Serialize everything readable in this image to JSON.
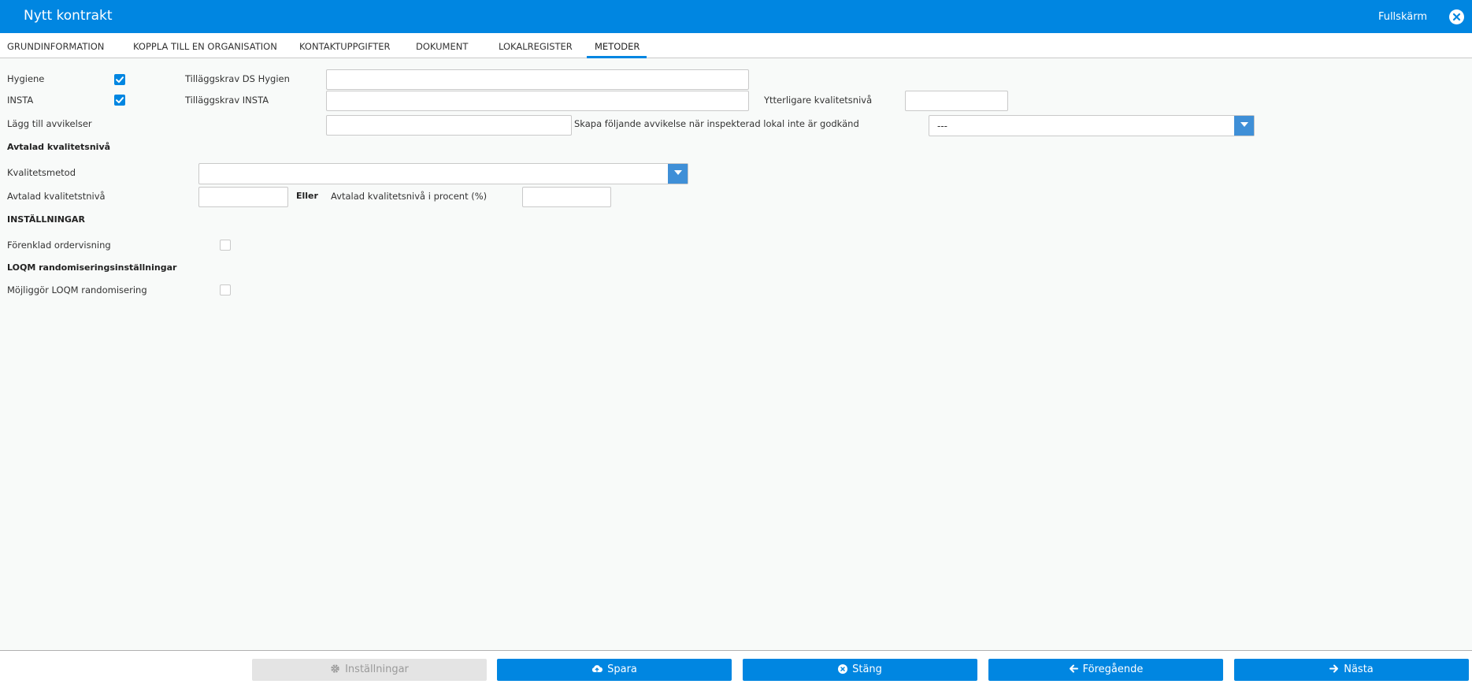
{
  "window": {
    "title": "Nytt kontrakt",
    "fullscreen_label": "Fullskärm"
  },
  "tabs": [
    {
      "label": "GRUNDINFORMATION"
    },
    {
      "label": "KOPPLA TILL EN ORGANISATION"
    },
    {
      "label": "KONTAKTUPPGIFTER"
    },
    {
      "label": "DOKUMENT"
    },
    {
      "label": "LOKALREGISTER"
    },
    {
      "label": "METODER",
      "active": true
    }
  ],
  "form": {
    "hygiene_label": "Hygiene",
    "hygiene_checked": true,
    "insta_label": "INSTA",
    "insta_checked": true,
    "tillagg_ds_label": "Tilläggskrav DS Hygien",
    "tillagg_ds_value": "",
    "tillagg_insta_label": "Tilläggskrav INSTA",
    "tillagg_insta_value": "",
    "ytterligare_label": "Ytterligare kvalitetsnivå",
    "ytterligare_value": "",
    "lagg_till_label": "Lägg till avvikelser",
    "lagg_till_value": "",
    "skapa_label": "Skapa följande avvikelse när inspekterad lokal inte är godkänd",
    "skapa_selected": "---",
    "avtalad_header": "Avtalad kvalitetsnivå",
    "kvalitetsmetod_label": "Kvalitetsmetod",
    "kvalitetsmetod_selected": "",
    "avtalad_niva_label": "Avtalad kvalitetstnivå",
    "avtalad_niva_value": "",
    "eller_label": "Eller",
    "avtalad_procent_label": "Avtalad kvalitetsnivå i procent (%)",
    "avtalad_procent_value": "",
    "installningar_header": "INSTÄLLNINGAR",
    "forenklad_label": "Förenklad ordervisning",
    "forenklad_checked": false,
    "loqm_header": "LOQM randomiseringsinställningar",
    "loqm_label": "Möjliggör LOQM randomisering",
    "loqm_checked": false
  },
  "footer": {
    "installningar_label": "Inställningar",
    "spara_label": "Spara",
    "stang_label": "Stäng",
    "foregaende_label": "Föregående",
    "nasta_label": "Nästa"
  },
  "colors": {
    "primary": "#0086e1",
    "disabled_bg": "#e4e4e4",
    "disabled_text": "#9a9a9a",
    "select_arrow": "#3f8fd7"
  },
  "icons": {
    "close": "close-circle-icon",
    "checkbox": "check-icon",
    "dropdown": "caret-down-icon",
    "settings": "gear-icon",
    "save": "cloud-upload-icon",
    "close_button": "times-circle-icon",
    "previous": "arrow-left-icon",
    "next": "arrow-right-icon"
  }
}
